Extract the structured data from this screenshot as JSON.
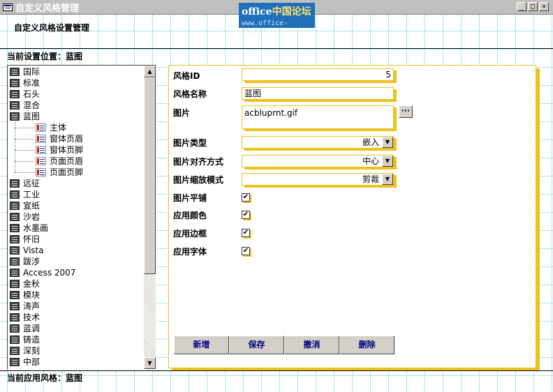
{
  "window": {
    "title": "自定义风格管理",
    "minimize": "_",
    "maximize": "□",
    "close": "×"
  },
  "logo": {
    "line1_a": "office",
    "line1_b": "中国论坛",
    "line2": "www.office-cn.net"
  },
  "header": {
    "title": "自定义风格设置管理"
  },
  "location": {
    "label": "当前设置位置：",
    "value": "蓝图"
  },
  "tree": {
    "items_before": [
      "国际",
      "标准",
      "石头",
      "混合",
      "蓝图"
    ],
    "children": [
      "主体",
      "窗体页眉",
      "窗体页脚",
      "页面页眉",
      "页面页脚"
    ],
    "items_after": [
      "远征",
      "工业",
      "宣纸",
      "沙岩",
      "水墨画",
      "怀旧",
      "Vista",
      "跋涉",
      "Access 2007",
      "金秋",
      "模块",
      "涛声",
      "技术",
      "蓝调",
      "铸造",
      "深刻",
      "中部"
    ]
  },
  "form": {
    "style_id_label": "风格ID",
    "style_id_value": "5",
    "style_name_label": "风格名称",
    "style_name_value": "蓝图",
    "picture_label": "图片",
    "picture_value": "acbluprnt.gif",
    "browse_label": "···",
    "picture_type_label": "图片类型",
    "picture_type_value": "嵌入",
    "picture_align_label": "图片对齐方式",
    "picture_align_value": "中心",
    "picture_zoom_label": "图片缩放模式",
    "picture_zoom_value": "剪裁",
    "picture_tile_label": "图片平铺",
    "apply_color_label": "应用颜色",
    "apply_border_label": "应用边框",
    "apply_font_label": "应用字体",
    "check_mark": "✔"
  },
  "buttons": {
    "new": "新增",
    "save": "保存",
    "undo": "撤消",
    "delete": "删除"
  },
  "footer": {
    "label": "当前应用风格：",
    "value": "蓝图"
  },
  "colors": {
    "title_bar": "#c0c0c0",
    "accent_yellow": "#f0c020",
    "grid": "#a8e4ec",
    "button_text": "#000080"
  }
}
